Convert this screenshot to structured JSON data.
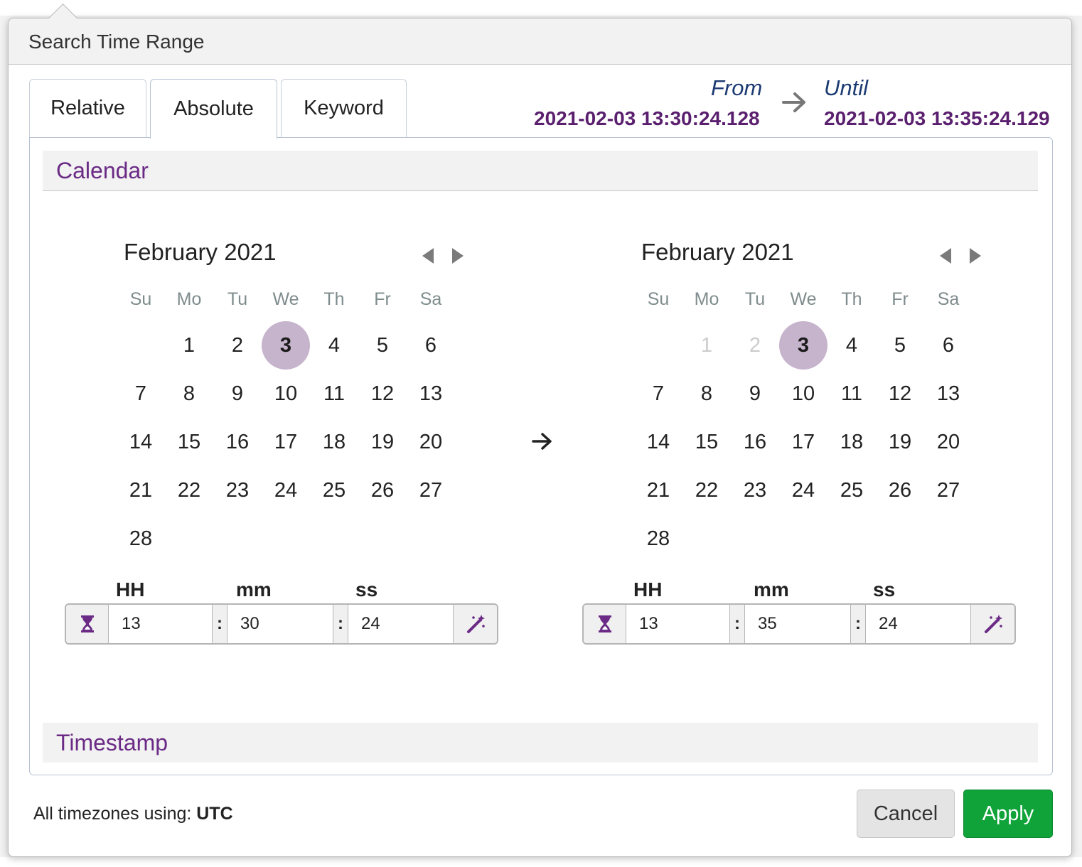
{
  "dialog": {
    "title": "Search Time Range"
  },
  "tabs": [
    {
      "label": "Relative",
      "active": false
    },
    {
      "label": "Absolute",
      "active": true
    },
    {
      "label": "Keyword",
      "active": false
    }
  ],
  "range": {
    "from_label": "From",
    "from_value": "2021-02-03 13:30:24.128",
    "until_label": "Until",
    "until_value": "2021-02-03 13:35:24.129"
  },
  "sections": {
    "calendar": "Calendar",
    "timestamp": "Timestamp"
  },
  "weekdays": [
    "Su",
    "Mo",
    "Tu",
    "We",
    "Th",
    "Fr",
    "Sa"
  ],
  "calendars": [
    {
      "title": "February 2021",
      "first_weekday_index": 1,
      "days": [
        "1",
        "2",
        "3",
        "4",
        "5",
        "6",
        "7",
        "8",
        "9",
        "10",
        "11",
        "12",
        "13",
        "14",
        "15",
        "16",
        "17",
        "18",
        "19",
        "20",
        "21",
        "22",
        "23",
        "24",
        "25",
        "26",
        "27",
        "28"
      ],
      "selected_day": "3",
      "disabled_days": [],
      "time": {
        "hh_label": "HH",
        "mm_label": "mm",
        "ss_label": "ss",
        "hh": "13",
        "mm": "30",
        "ss": "24",
        "separator": ":"
      }
    },
    {
      "title": "February 2021",
      "first_weekday_index": 1,
      "days": [
        "1",
        "2",
        "3",
        "4",
        "5",
        "6",
        "7",
        "8",
        "9",
        "10",
        "11",
        "12",
        "13",
        "14",
        "15",
        "16",
        "17",
        "18",
        "19",
        "20",
        "21",
        "22",
        "23",
        "24",
        "25",
        "26",
        "27",
        "28"
      ],
      "selected_day": "3",
      "disabled_days": [
        "1",
        "2"
      ],
      "time": {
        "hh_label": "HH",
        "mm_label": "mm",
        "ss_label": "ss",
        "hh": "13",
        "mm": "35",
        "ss": "24",
        "separator": ":"
      }
    }
  ],
  "icons": {
    "prev": "triangle-left-icon",
    "next": "triangle-right-icon",
    "hourglass": "hourglass-icon",
    "wand": "magic-wand-icon",
    "arrow": "arrow-right-icon"
  },
  "footer": {
    "timezone_label": "All timezones using:",
    "timezone_value": "UTC",
    "cancel_label": "Cancel",
    "apply_label": "Apply"
  },
  "colors": {
    "accent_purple": "#6a2a85",
    "selected_day_bg": "#c6b3cc",
    "apply_green": "#10a33a",
    "from_until_blue": "#1c3b73"
  }
}
